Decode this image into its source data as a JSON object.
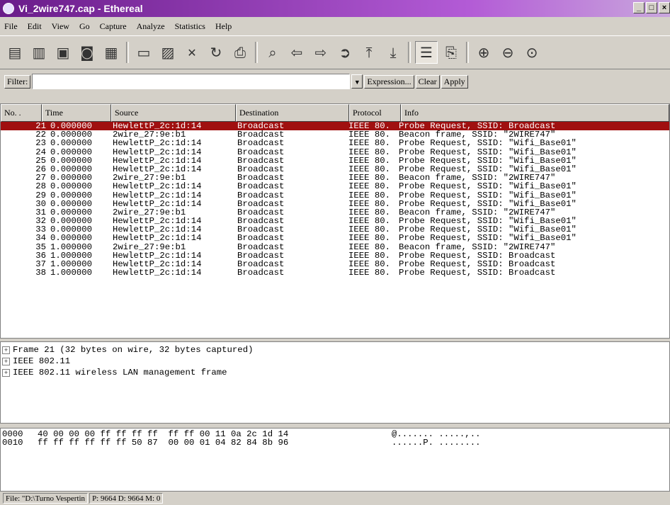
{
  "window": {
    "title": "Vi_2wire747.cap - Ethereal"
  },
  "menu": [
    "File",
    "Edit",
    "View",
    "Go",
    "Capture",
    "Analyze",
    "Statistics",
    "Help"
  ],
  "toolbar": {
    "icons": [
      "interfaces-icon",
      "capture-options-icon",
      "start-capture-icon",
      "stop-capture-icon",
      "restart-capture-icon",
      "open-icon",
      "save-icon",
      "close-icon",
      "reload-icon",
      "print-icon",
      "find-icon",
      "back-icon",
      "forward-icon",
      "goto-icon",
      "first-icon",
      "last-icon",
      "colorize-icon",
      "autoscroll-icon",
      "zoom-in-icon",
      "zoom-out-icon",
      "zoom-normal-icon"
    ]
  },
  "filter": {
    "label": "Filter:",
    "value": "",
    "expression": "Expression...",
    "clear": "Clear",
    "apply": "Apply"
  },
  "columns": [
    "No. .",
    "Time",
    "Source",
    "Destination",
    "Protocol",
    "Info"
  ],
  "packets": [
    {
      "no": "21",
      "time": "0.000000",
      "src": "HewlettP_2c:1d:14",
      "dst": "Broadcast",
      "proto": "IEEE 80.",
      "info": "Probe Request, SSID: Broadcast"
    },
    {
      "no": "22",
      "time": "0.000000",
      "src": "2wire_27:9e:b1",
      "dst": "Broadcast",
      "proto": "IEEE 80.",
      "info": "Beacon frame, SSID: \"2WIRE747\""
    },
    {
      "no": "23",
      "time": "0.000000",
      "src": "HewlettP_2c:1d:14",
      "dst": "Broadcast",
      "proto": "IEEE 80.",
      "info": "Probe Request, SSID: \"Wifi_Base01\""
    },
    {
      "no": "24",
      "time": "0.000000",
      "src": "HewlettP_2c:1d:14",
      "dst": "Broadcast",
      "proto": "IEEE 80.",
      "info": "Probe Request, SSID: \"Wifi_Base01\""
    },
    {
      "no": "25",
      "time": "0.000000",
      "src": "HewlettP_2c:1d:14",
      "dst": "Broadcast",
      "proto": "IEEE 80.",
      "info": "Probe Request, SSID: \"Wifi_Base01\""
    },
    {
      "no": "26",
      "time": "0.000000",
      "src": "HewlettP_2c:1d:14",
      "dst": "Broadcast",
      "proto": "IEEE 80.",
      "info": "Probe Request, SSID: \"Wifi_Base01\""
    },
    {
      "no": "27",
      "time": "0.000000",
      "src": "2wire_27:9e:b1",
      "dst": "Broadcast",
      "proto": "IEEE 80.",
      "info": "Beacon frame, SSID: \"2WIRE747\""
    },
    {
      "no": "28",
      "time": "0.000000",
      "src": "HewlettP_2c:1d:14",
      "dst": "Broadcast",
      "proto": "IEEE 80.",
      "info": "Probe Request, SSID: \"Wifi_Base01\""
    },
    {
      "no": "29",
      "time": "0.000000",
      "src": "HewlettP_2c:1d:14",
      "dst": "Broadcast",
      "proto": "IEEE 80.",
      "info": "Probe Request, SSID: \"Wifi_Base01\""
    },
    {
      "no": "30",
      "time": "0.000000",
      "src": "HewlettP_2c:1d:14",
      "dst": "Broadcast",
      "proto": "IEEE 80.",
      "info": "Probe Request, SSID: \"Wifi_Base01\""
    },
    {
      "no": "31",
      "time": "0.000000",
      "src": "2wire_27:9e:b1",
      "dst": "Broadcast",
      "proto": "IEEE 80.",
      "info": "Beacon frame, SSID: \"2WIRE747\""
    },
    {
      "no": "32",
      "time": "0.000000",
      "src": "HewlettP_2c:1d:14",
      "dst": "Broadcast",
      "proto": "IEEE 80.",
      "info": "Probe Request, SSID: \"Wifi_Base01\""
    },
    {
      "no": "33",
      "time": "0.000000",
      "src": "HewlettP_2c:1d:14",
      "dst": "Broadcast",
      "proto": "IEEE 80.",
      "info": "Probe Request, SSID: \"Wifi_Base01\""
    },
    {
      "no": "34",
      "time": "0.000000",
      "src": "HewlettP_2c:1d:14",
      "dst": "Broadcast",
      "proto": "IEEE 80.",
      "info": "Probe Request, SSID: \"Wifi_Base01\""
    },
    {
      "no": "35",
      "time": "1.000000",
      "src": "2wire_27:9e:b1",
      "dst": "Broadcast",
      "proto": "IEEE 80.",
      "info": "Beacon frame, SSID: \"2WIRE747\""
    },
    {
      "no": "36",
      "time": "1.000000",
      "src": "HewlettP_2c:1d:14",
      "dst": "Broadcast",
      "proto": "IEEE 80.",
      "info": "Probe Request, SSID: Broadcast"
    },
    {
      "no": "37",
      "time": "1.000000",
      "src": "HewlettP_2c:1d:14",
      "dst": "Broadcast",
      "proto": "IEEE 80.",
      "info": "Probe Request, SSID: Broadcast"
    },
    {
      "no": "38",
      "time": "1.000000",
      "src": "HewlettP_2c:1d:14",
      "dst": "Broadcast",
      "proto": "IEEE 80.",
      "info": "Probe Request, SSID: Broadcast"
    }
  ],
  "selected_index": 0,
  "details": [
    "Frame 21 (32 bytes on wire, 32 bytes captured)",
    "IEEE 802.11",
    "IEEE 802.11 wireless LAN management frame"
  ],
  "hex": [
    {
      "offset": "0000",
      "bytes": "40 00 00 00 ff ff ff ff  ff ff 00 11 0a 2c 1d 14",
      "ascii": "@....... .....,.."
    },
    {
      "offset": "0010",
      "bytes": "ff ff ff ff ff ff 50 87  00 00 01 04 82 84 8b 96",
      "ascii": "......P. ........"
    }
  ],
  "status": {
    "file": "File: \"D:\\Turno Vespertin",
    "counts": "P: 9664 D: 9664 M: 0"
  }
}
